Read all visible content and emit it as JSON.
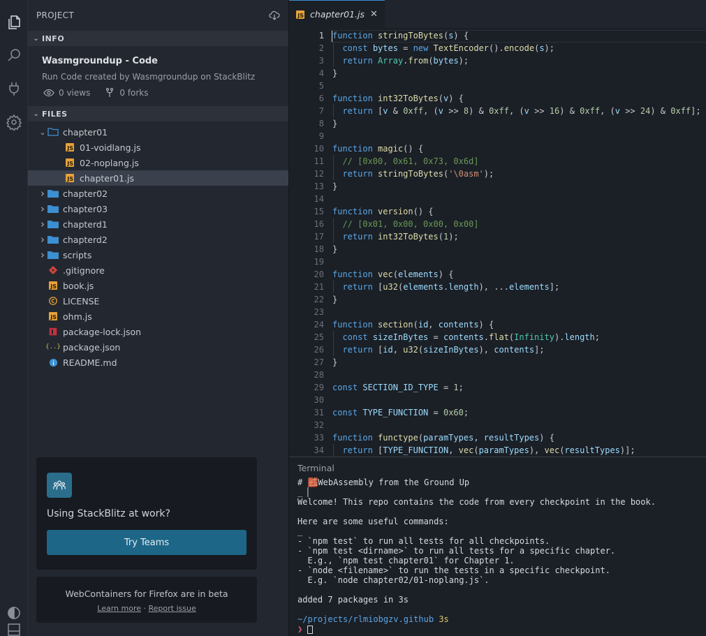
{
  "activity_bar": {
    "icons": [
      "files-icon",
      "search-icon",
      "plug-icon",
      "gear-icon",
      "theme-toggle-icon",
      "panel-icon"
    ]
  },
  "sidebar": {
    "header": "PROJECT",
    "info_section": "INFO",
    "project_title": "Wasmgroundup - Code",
    "project_subtitle": "Run Code created by Wasmgroundup on StackBlitz",
    "views": "0 views",
    "forks": "0 forks",
    "files_section": "FILES",
    "tree": [
      {
        "name": "chapter01",
        "type": "folder-open",
        "depth": 0
      },
      {
        "name": "01-voidlang.js",
        "type": "js",
        "depth": 1
      },
      {
        "name": "02-noplang.js",
        "type": "js",
        "depth": 1
      },
      {
        "name": "chapter01.js",
        "type": "js",
        "depth": 1,
        "selected": true
      },
      {
        "name": "chapter02",
        "type": "folder",
        "depth": 0
      },
      {
        "name": "chapter03",
        "type": "folder",
        "depth": 0
      },
      {
        "name": "chapterd1",
        "type": "folder",
        "depth": 0
      },
      {
        "name": "chapterd2",
        "type": "folder",
        "depth": 0
      },
      {
        "name": "scripts",
        "type": "folder",
        "depth": 0
      },
      {
        "name": ".gitignore",
        "type": "git",
        "depth": 0
      },
      {
        "name": "book.js",
        "type": "js",
        "depth": 0
      },
      {
        "name": "LICENSE",
        "type": "license",
        "depth": 0
      },
      {
        "name": "ohm.js",
        "type": "js",
        "depth": 0
      },
      {
        "name": "package-lock.json",
        "type": "npm",
        "depth": 0
      },
      {
        "name": "package.json",
        "type": "json",
        "depth": 0
      },
      {
        "name": "README.md",
        "type": "info",
        "depth": 0
      }
    ],
    "teams_card": {
      "text": "Using StackBlitz at work?",
      "button": "Try Teams"
    },
    "firefox_card": {
      "text": "WebContainers for Firefox are in beta",
      "learn_more": "Learn more",
      "separator": " · ",
      "report_issue": "Report issue"
    }
  },
  "editor": {
    "tab_label": "chapter01.js",
    "tab_close": "✕",
    "lines": [
      "function stringToBytes(s) {",
      "  const bytes = new TextEncoder().encode(s);",
      "  return Array.from(bytes);",
      "}",
      "",
      "function int32ToBytes(v) {",
      "  return [v & 0xff, (v >> 8) & 0xff, (v >> 16) & 0xff, (v >> 24) & 0xff];",
      "}",
      "",
      "function magic() {",
      "  // [0x00, 0x61, 0x73, 0x6d]",
      "  return stringToBytes('\\0asm');",
      "}",
      "",
      "function version() {",
      "  // [0x01, 0x00, 0x00, 0x00]",
      "  return int32ToBytes(1);",
      "}",
      "",
      "function vec(elements) {",
      "  return [u32(elements.length), ...elements];",
      "}",
      "",
      "function section(id, contents) {",
      "  const sizeInBytes = contents.flat(Infinity).length;",
      "  return [id, u32(sizeInBytes), contents];",
      "}",
      "",
      "const SECTION_ID_TYPE = 1;",
      "",
      "const TYPE_FUNCTION = 0x60;",
      "",
      "function functype(paramTypes, resultTypes) {",
      "  return [TYPE_FUNCTION, vec(paramTypes), vec(resultTypes)];"
    ]
  },
  "terminal": {
    "title": "Terminal",
    "lines": [
      "# 🧱WebAssembly from the Ground Up",
      "_ ▏",
      "Welcome! This repo contains the code from every checkpoint in the book.",
      "",
      "Here are some useful commands:",
      "_",
      "- `npm test` to run all tests for all checkpoints.",
      "- `npm test <dirname>` to run all tests for a specific chapter.",
      "  E.g., `npm test chapter01` for Chapter 1.",
      "- `node <filename>` to run the tests in a specific checkpoint.",
      "  E.g. `node chapter02/01-noplang.js`.",
      "",
      "added 7 packages in 3s",
      ""
    ],
    "path": "~/projects/rlmiobgzv.github",
    "time": "3s",
    "prompt": "❯"
  },
  "colors": {
    "accent": "#3d8fd1",
    "folder": "#3d8fd1",
    "js_badge": "#e8a13a",
    "teams_button": "#1d6687"
  }
}
